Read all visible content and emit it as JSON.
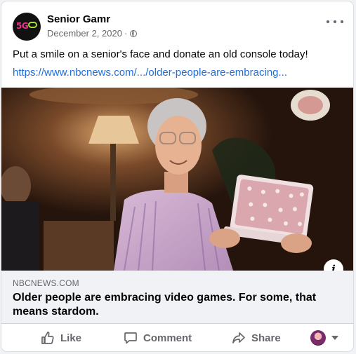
{
  "post": {
    "page_name": "Senior Gamr",
    "avatar_text": "5G",
    "date": "December 2, 2020",
    "separator": "·",
    "text": "Put a smile on a senior's face and donate an old console today!",
    "link": "https://www.nbcnews.com/.../older-people-are-embracing..."
  },
  "preview": {
    "domain": "NBCNEWS.COM",
    "headline": "Older people are embracing video games. For some, that means stardom."
  },
  "actions": {
    "like": "Like",
    "comment": "Comment",
    "share": "Share"
  },
  "icons": {
    "more": "more-options-icon",
    "globe": "globe-icon",
    "info": "info-icon",
    "like": "thumbs-up-icon",
    "comment": "comment-bubble-icon",
    "share": "share-arrow-icon",
    "reaction": "profile-avatar",
    "caret": "chevron-down-icon"
  },
  "colors": {
    "link": "#216fdb",
    "muted": "#65676b",
    "preview_bg": "#f0f2f5",
    "avatar_accent": "#e8378a"
  }
}
